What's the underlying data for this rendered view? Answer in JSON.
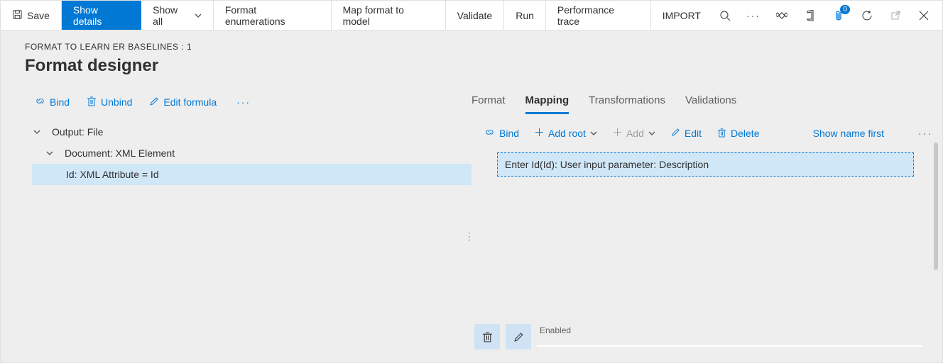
{
  "toolbar": {
    "save": "Save",
    "show_details": "Show details",
    "show_all": "Show all",
    "format_enum": "Format enumerations",
    "map_format": "Map format to model",
    "validate": "Validate",
    "run": "Run",
    "perf_trace": "Performance trace",
    "import": "IMPORT",
    "badge_count": "0"
  },
  "breadcrumb": "FORMAT TO LEARN ER BASELINES : 1",
  "title": "Format designer",
  "left": {
    "bind": "Bind",
    "unbind": "Unbind",
    "edit_formula": "Edit formula"
  },
  "tree": {
    "n0": "Output: File",
    "n1": "Document: XML Element",
    "n2": "Id: XML Attribute = Id"
  },
  "tabs": {
    "format": "Format",
    "mapping": "Mapping",
    "transformations": "Transformations",
    "validations": "Validations"
  },
  "right_actions": {
    "bind": "Bind",
    "add_root": "Add root",
    "add": "Add",
    "edit": "Edit",
    "delete": "Delete",
    "show_name": "Show name first"
  },
  "mapping_item": "Enter Id(Id): User input parameter: Description",
  "bottom": {
    "enabled_label": "Enabled"
  }
}
